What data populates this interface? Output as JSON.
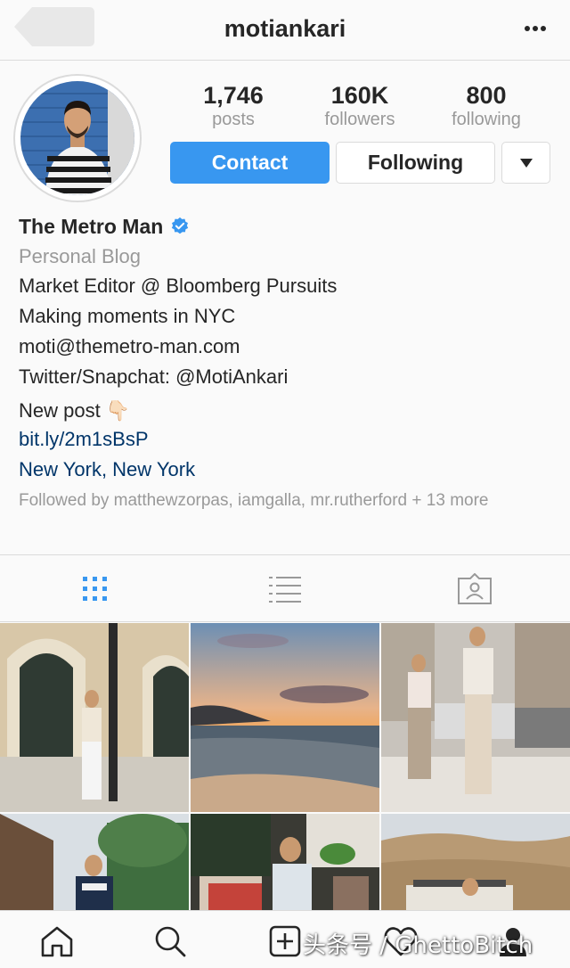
{
  "header": {
    "username": "motiankari",
    "back_icon": "back-arrow-icon",
    "more_icon": "more-dots-icon"
  },
  "stats": {
    "posts": {
      "value": "1,746",
      "label": "posts"
    },
    "followers": {
      "value": "160K",
      "label": "followers"
    },
    "following": {
      "value": "800",
      "label": "following"
    }
  },
  "actions": {
    "contact_label": "Contact",
    "following_label": "Following",
    "dropdown_icon": "triangle-down-icon"
  },
  "bio": {
    "name": "The Metro Man",
    "category": "Personal Blog",
    "lines": [
      "Market Editor @ Bloomberg Pursuits",
      "Making moments in NYC",
      "moti@themetro-man.com",
      "Twitter/Snapchat: @MotiAnkari",
      "New post 👇🏻"
    ],
    "link": "bit.ly/2m1sBsP",
    "location": "New York, New York",
    "followed_by": "Followed by matthewzorpas, iamgalla, mr.rutherford + 13 more"
  },
  "tabs": [
    "grid-icon",
    "list-icon",
    "tagged-icon"
  ],
  "bottom_nav": [
    "home-icon",
    "search-icon",
    "add-icon",
    "heart-icon",
    "profile-icon"
  ],
  "watermark": "头条号 / GhettoBitch",
  "colors": {
    "accent": "#3897f0",
    "link": "#003569",
    "muted": "#999999",
    "border": "#dbdbdb",
    "background": "#fafafa"
  }
}
